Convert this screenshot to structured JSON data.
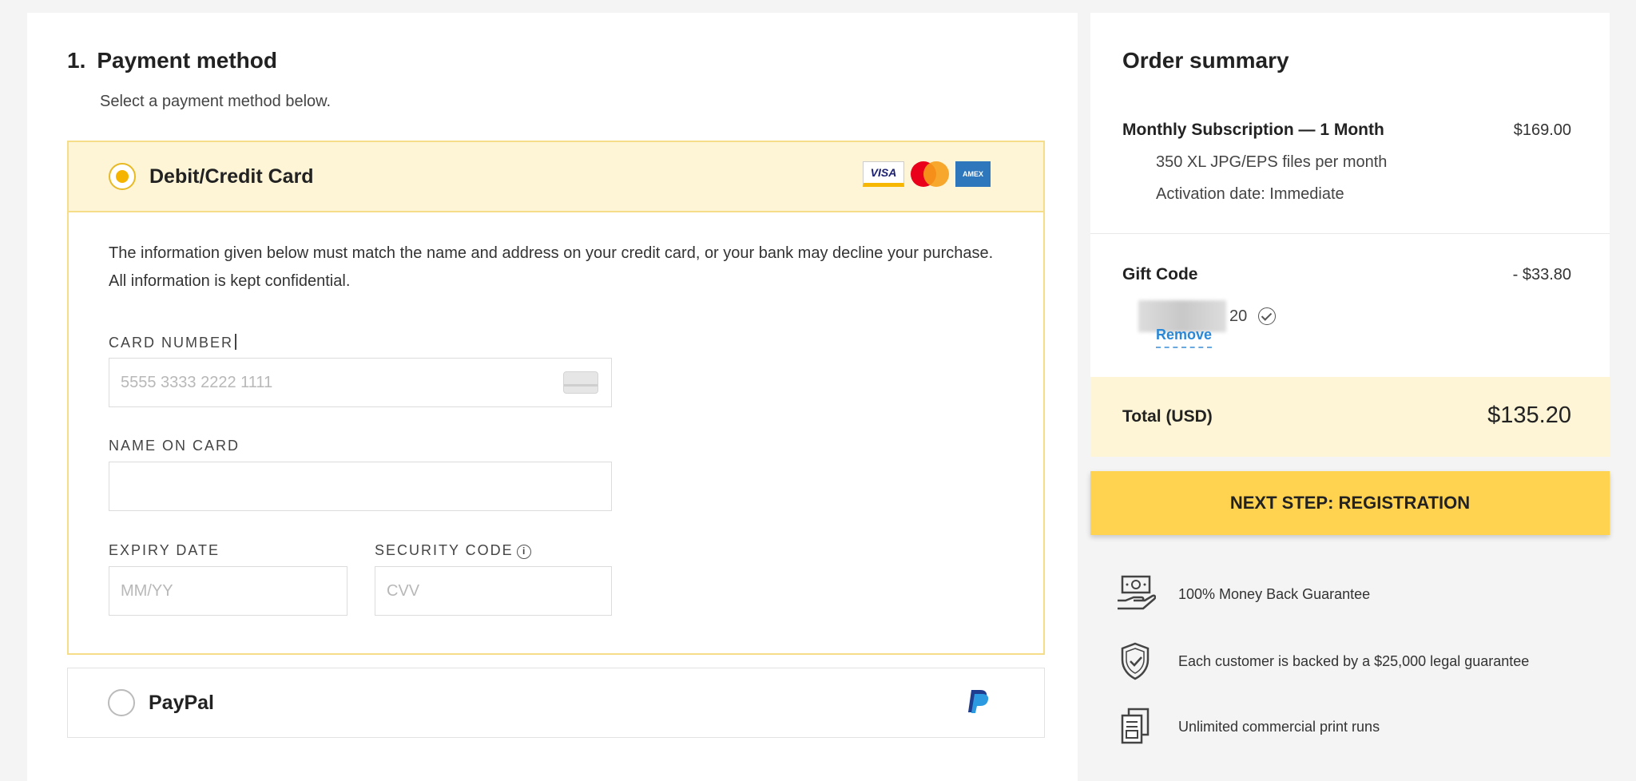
{
  "payment": {
    "step_number": "1.",
    "title": "Payment method",
    "subtitle": "Select a payment method below.",
    "card_option": {
      "label": "Debit/Credit Card",
      "selected": true,
      "logos": {
        "visa": "VISA",
        "amex": "AMEX"
      },
      "info_text": "The information given below must match the name and address on your credit card, or your bank may decline your purchase. All information is kept confidential.",
      "card_number": {
        "label": "CARD NUMBER",
        "placeholder": "5555 3333 2222 1111",
        "value": ""
      },
      "name_on_card": {
        "label": "NAME ON CARD",
        "placeholder": "",
        "value": ""
      },
      "expiry_date": {
        "label": "EXPIRY DATE",
        "placeholder": "MM/YY",
        "value": ""
      },
      "security_code": {
        "label": "SECURITY CODE",
        "info_glyph": "i",
        "placeholder": "CVV",
        "value": ""
      }
    },
    "paypal_option": {
      "label": "PayPal",
      "selected": false
    }
  },
  "summary": {
    "title": "Order summary",
    "subscription": {
      "name": "Monthly Subscription — 1 Month",
      "price": "$169.00",
      "details": [
        "350 XL JPG/EPS files per month",
        "Activation date: Immediate"
      ]
    },
    "gift": {
      "label": "Gift Code",
      "discount": "- $33.80",
      "code_suffix": "20",
      "remove_label": "Remove"
    },
    "total": {
      "label": "Total (USD)",
      "value": "$135.20"
    },
    "next_button": "NEXT STEP: REGISTRATION",
    "guarantees": [
      {
        "icon": "money-hand-icon",
        "text": "100% Money Back Guarantee"
      },
      {
        "icon": "shield-check-icon",
        "text": "Each customer is backed by a $25,000 legal guarantee"
      },
      {
        "icon": "print-copies-icon",
        "text": "Unlimited commercial print runs"
      }
    ]
  },
  "colors": {
    "accent_yellow": "#ffd34f",
    "highlight_bg": "#fef5d6",
    "highlight_border": "#f6dd8a",
    "radio_fill": "#f5b400",
    "link_blue": "#2a88d6"
  }
}
